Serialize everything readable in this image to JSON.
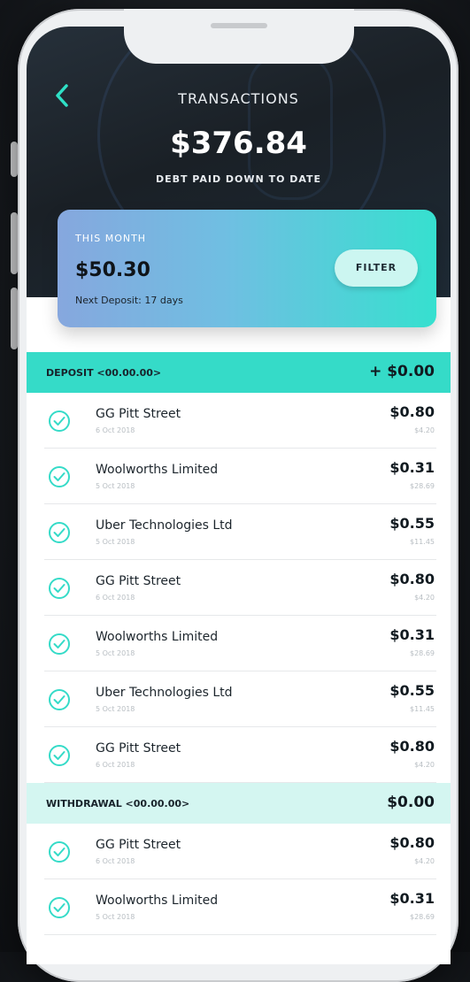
{
  "header": {
    "title": "TRANSACTIONS",
    "amount": "$376.84",
    "subtitle": "DEBT PAID DOWN TO DATE"
  },
  "month_card": {
    "label": "THIS MONTH",
    "amount": "$50.30",
    "next_deposit": "Next Deposit: 17 days",
    "filter_label": "FILTER"
  },
  "deposit": {
    "label": "DEPOSIT <00.00.00>",
    "total": "+ $0.00",
    "items": [
      {
        "merchant": "GG Pitt Street",
        "date": "6 Oct 2018",
        "rounded": "$0.80",
        "original": "$4.20"
      },
      {
        "merchant": "Woolworths Limited",
        "date": "5 Oct 2018",
        "rounded": "$0.31",
        "original": "$28.69"
      },
      {
        "merchant": "Uber Technologies Ltd",
        "date": "5 Oct 2018",
        "rounded": "$0.55",
        "original": "$11.45"
      },
      {
        "merchant": "GG Pitt Street",
        "date": "6 Oct 2018",
        "rounded": "$0.80",
        "original": "$4.20"
      },
      {
        "merchant": "Woolworths Limited",
        "date": "5 Oct 2018",
        "rounded": "$0.31",
        "original": "$28.69"
      },
      {
        "merchant": "Uber Technologies Ltd",
        "date": "5 Oct 2018",
        "rounded": "$0.55",
        "original": "$11.45"
      },
      {
        "merchant": "GG Pitt Street",
        "date": "6 Oct 2018",
        "rounded": "$0.80",
        "original": "$4.20"
      }
    ]
  },
  "withdrawal": {
    "label": "WITHDRAWAL <00.00.00>",
    "total": "$0.00",
    "items": [
      {
        "merchant": "GG Pitt Street",
        "date": "6 Oct 2018",
        "rounded": "$0.80",
        "original": "$4.20"
      },
      {
        "merchant": "Woolworths Limited",
        "date": "5 Oct 2018",
        "rounded": "$0.31",
        "original": "$28.69"
      }
    ]
  },
  "colors": {
    "accent": "#35dbc8",
    "accent_light": "#d4f6f1",
    "header_dark": "#1a2026"
  },
  "icons": {
    "back": "chevron-left-icon",
    "check": "check-circle-icon"
  }
}
